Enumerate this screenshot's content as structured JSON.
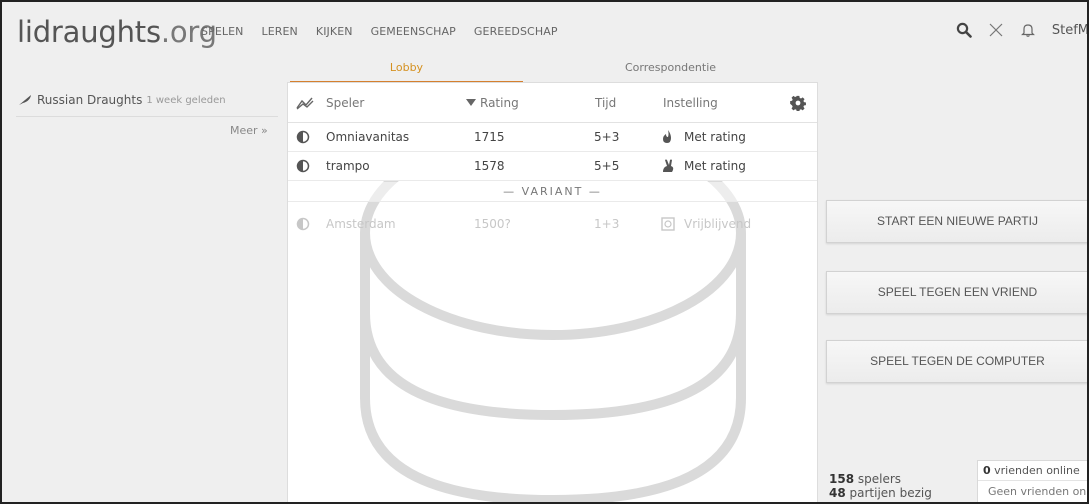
{
  "header": {
    "logo_main": "lidraughts",
    "logo_tld": ".org",
    "nav": [
      "SPELEN",
      "LEREN",
      "KIJKEN",
      "GEMEENSCHAP",
      "GEREEDSCHAP"
    ],
    "user": "StefM",
    "icons": [
      "search-icon",
      "swords-icon",
      "bell-icon"
    ]
  },
  "sidebar": {
    "recent_title": "Russian Draughts",
    "recent_ago": "1 week geleden",
    "more_link": "Meer »"
  },
  "tabs": {
    "lobby": "Lobby",
    "correspondence": "Correspondentie",
    "active": "lobby",
    "accent": "#d5802f"
  },
  "table": {
    "headers": {
      "player": "Speler",
      "rating": "Rating",
      "time": "Tijd",
      "mode": "Instelling"
    },
    "rows": [
      {
        "player": "Omniavanitas",
        "rating": "1715",
        "time": "5+3",
        "mode": "Met rating",
        "mode_icon": "flame-icon"
      },
      {
        "player": "trampo",
        "rating": "1578",
        "time": "5+5",
        "mode": "Met rating",
        "mode_icon": "rabbit-icon"
      }
    ],
    "variant_separator": "— VARIANT —",
    "variant_rows": [
      {
        "player": "Amsterdam",
        "rating": "1500?",
        "time": "1+3",
        "mode": "Vrijblijvend",
        "mode_icon": "square-icon"
      }
    ]
  },
  "actions": {
    "new_game": "START EEN NIEUWE PARTIJ",
    "vs_friend": "SPEEL TEGEN EEN VRIEND",
    "vs_computer": "SPEEL TEGEN DE COMPUTER"
  },
  "stats": {
    "players_count": "158",
    "players_label": " spelers",
    "games_count": "48",
    "games_label": " partijen bezig"
  },
  "friends": {
    "count": "0",
    "label": " vrienden online",
    "empty": "Geen vrienden online"
  }
}
